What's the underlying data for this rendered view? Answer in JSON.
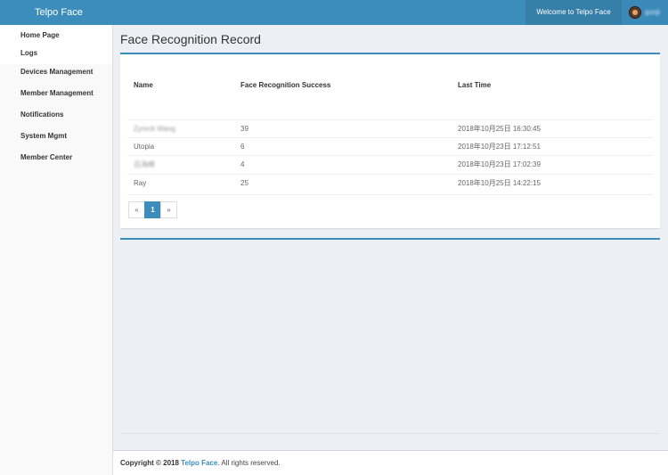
{
  "header": {
    "brand": "Telpo Face",
    "welcome": "Welcome to Telpo Face",
    "username": "guoji"
  },
  "sidebar": {
    "items": [
      {
        "label": "Home Page"
      },
      {
        "label": "Logs"
      },
      {
        "label": "Devices Management"
      },
      {
        "label": "Member Management"
      },
      {
        "label": "Notifications"
      },
      {
        "label": "System Mgmt"
      },
      {
        "label": "Member Center"
      }
    ]
  },
  "main": {
    "title": "Face Recognition Record",
    "table": {
      "headers": [
        "Name",
        "Face Recognition Success",
        "Last Time"
      ],
      "rows": [
        {
          "name": "Zyreck Wang",
          "success": "39",
          "last": "2018年10月25日 16:30:45"
        },
        {
          "name": "Utopia",
          "success": "6",
          "last": "2018年10月23日 17:12:51"
        },
        {
          "name": "吕海峰",
          "success": "4",
          "last": "2018年10月23日 17:02:39"
        },
        {
          "name": "Ray",
          "success": "25",
          "last": "2018年10月25日 14:22:15"
        }
      ]
    },
    "pagination": {
      "prev": "«",
      "current": "1",
      "next": "»"
    }
  },
  "footer": {
    "copyright": "Copyright © 2018",
    "company": "Telpo Face",
    "suffix": ". All rights reserved."
  },
  "colors": {
    "accent": "#3c8dbc",
    "header_dark": "#367fa9"
  }
}
